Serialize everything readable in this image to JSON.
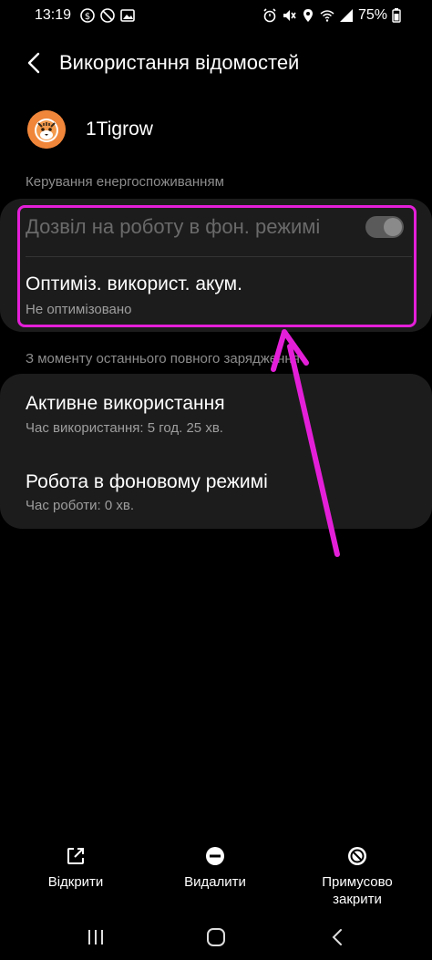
{
  "status_bar": {
    "time": "13:19",
    "battery": "75%"
  },
  "header": {
    "title": "Використання відомостей"
  },
  "app": {
    "name": "1Tigrow"
  },
  "power_section": {
    "title": "Керування енергоспоживанням",
    "background_label": "Дозвіл на роботу в фон. режимі",
    "background_toggle": "on",
    "optimize_title": "Оптиміз. використ. акум.",
    "optimize_value": "Не оптимізовано"
  },
  "usage_section": {
    "title": "З моменту останнього повного зарядження",
    "active_title": "Активне використання",
    "active_value": "Час використання: 5 год. 25 хв.",
    "background_title": "Робота в фоновому режимі",
    "background_value": "Час роботи: 0 хв."
  },
  "actions": {
    "open": "Відкрити",
    "delete": "Видалити",
    "force_stop_line1": "Примусово",
    "force_stop_line2": "закрити"
  },
  "colors": {
    "highlight": "#e41fd8",
    "card": "#1c1c1c",
    "app_icon": "#f0863a"
  }
}
